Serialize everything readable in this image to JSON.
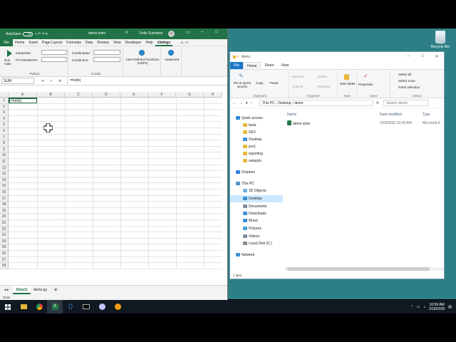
{
  "excel": {
    "autosave_label": "AutoSave",
    "autosave_state": "Off",
    "doc_name": "demo.xlsm",
    "user_name": "Felix Zumstein",
    "user_initials": "FZ",
    "tabs": [
      "File",
      "Home",
      "Insert",
      "Page Layout",
      "Formulas",
      "Data",
      "Review",
      "View",
      "Developer",
      "Help",
      "xlwings"
    ],
    "active_tab": "xlwings",
    "ribbon": {
      "run_label": "Run main",
      "interpreter_label": "Interpreter:",
      "pythonpath_label": "PYTHONPATH:",
      "python_group": "Python",
      "conda_base_label": "Conda Base:",
      "conda_env_label": "Conda Env:",
      "conda_group": "Conda",
      "udf_label": "User Defined Functions (UDFs)",
      "advanced_label": "Advanced"
    },
    "name_box": "SUM",
    "formula": "=hello(",
    "columns": [
      "A",
      "B",
      "C",
      "D",
      "E",
      "F",
      "G",
      "H"
    ],
    "rows": [
      "1",
      "2",
      "3",
      "4",
      "5",
      "6",
      "7",
      "8",
      "9",
      "10",
      "11",
      "12",
      "13",
      "14",
      "15",
      "16",
      "17",
      "18",
      "19",
      "20",
      "21",
      "22",
      "23",
      "24",
      "25",
      "26",
      "27",
      "28"
    ],
    "cell_a1": "=hello(",
    "sheet_tabs": [
      "Sheet1",
      "demo.py"
    ],
    "active_sheet": "Sheet1",
    "status": "Enter"
  },
  "explorer": {
    "title": "demo",
    "tabs": [
      "File",
      "Home",
      "Share",
      "View"
    ],
    "active_tab": "Home",
    "ribbon": {
      "pin_label": "Pin to Quick access",
      "copy_label": "Copy",
      "paste_label": "Paste",
      "clipboard_group": "Clipboard",
      "move_label": "Move to",
      "copy_to_label": "Copy to",
      "delete_label": "Delete",
      "rename_label": "Rename",
      "organize_group": "Organize",
      "new_folder_label": "New folder",
      "new_group": "New",
      "properties_label": "Properties",
      "open_group": "Open",
      "select_all_label": "Select all",
      "select_none_label": "Select none",
      "invert_label": "Invert selection",
      "select_group": "Select"
    },
    "breadcrumb": [
      "This PC",
      "Desktop",
      "demo"
    ],
    "search_placeholder": "Search demo",
    "nav": [
      {
        "label": "Quick access",
        "icon": "star-icon",
        "color": "#2b88d8"
      },
      {
        "label": "fasla",
        "icon": "folder-icon",
        "color": "#e8b83a"
      },
      {
        "label": "DEV",
        "icon": "folder-icon",
        "color": "#e8b83a"
      },
      {
        "label": "Desktop",
        "icon": "desktop-icon",
        "color": "#3d8fd6"
      },
      {
        "label": "pro1",
        "icon": "folder-icon",
        "color": "#e8b83a"
      },
      {
        "label": "reporting",
        "icon": "folder-icon",
        "color": "#e8b83a"
      },
      {
        "label": "xwquick",
        "icon": "folder-icon",
        "color": "#e8b83a"
      },
      {
        "label": "Dropbox",
        "icon": "dropbox-icon",
        "color": "#2f7fe0"
      },
      {
        "label": "This PC",
        "icon": "pc-icon",
        "color": "#4a90c8"
      },
      {
        "label": "3D Objects",
        "icon": "cube-icon",
        "color": "#6fb2e6"
      },
      {
        "label": "Desktop",
        "icon": "desktop-icon",
        "color": "#3d8fd6"
      },
      {
        "label": "Documents",
        "icon": "document-icon",
        "color": "#7d8ea0"
      },
      {
        "label": "Downloads",
        "icon": "download-icon",
        "color": "#3d8fd6"
      },
      {
        "label": "Music",
        "icon": "music-icon",
        "color": "#3d8fd6"
      },
      {
        "label": "Pictures",
        "icon": "picture-icon",
        "color": "#4aa0d8"
      },
      {
        "label": "Videos",
        "icon": "video-icon",
        "color": "#7d8ea0"
      },
      {
        "label": "Local Disk (C:)",
        "icon": "disk-icon",
        "color": "#8a8a8a"
      },
      {
        "label": "Network",
        "icon": "network-icon",
        "color": "#3d8fd6"
      }
    ],
    "columns": {
      "name": "Name",
      "modified": "Date modified",
      "type": "Type"
    },
    "file": {
      "name": "demo.xlsm",
      "modified": "2/18/2020 10:39 AM",
      "type": "Microsoft E"
    },
    "status": "1 item"
  },
  "desktop": {
    "recycle_bin": "Recycle Bin"
  },
  "taskbar": {
    "time": "10:59 AM",
    "date": "2/18/2020"
  }
}
